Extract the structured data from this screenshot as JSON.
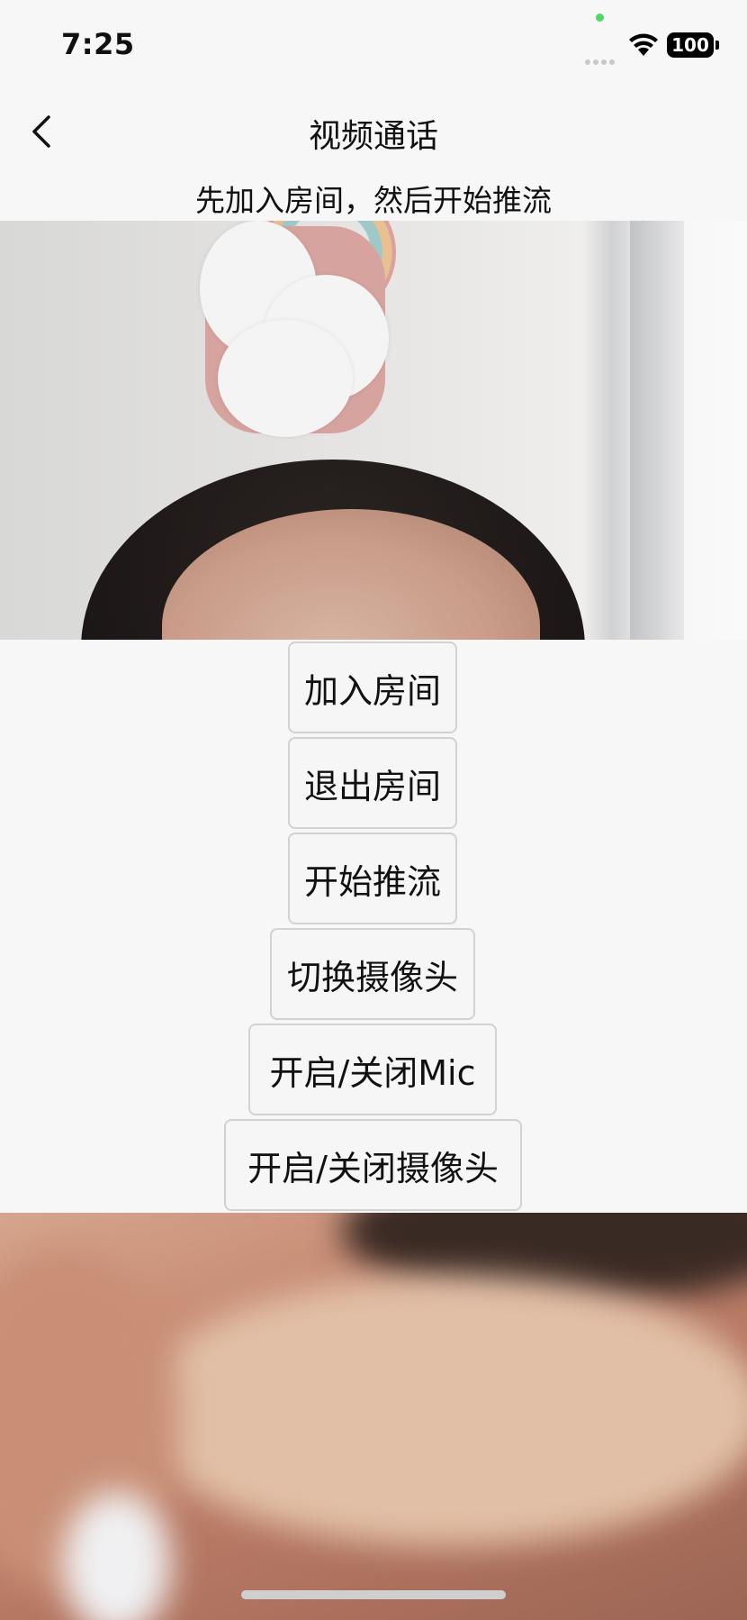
{
  "status_bar": {
    "time": "7:25",
    "battery": "100"
  },
  "nav": {
    "title": "视频通话"
  },
  "hint": "先加入房间，然后开始推流",
  "buttons": {
    "join_room": "加入房间",
    "leave_room": "退出房间",
    "start_push": "开始推流",
    "switch_camera": "切换摄像头",
    "toggle_mic": "开启/关闭Mic",
    "toggle_camera": "开启/关闭摄像头"
  },
  "icons": {
    "back": "chevron-left-icon",
    "wifi": "wifi-icon",
    "battery": "battery-icon",
    "signal": "cellular-signal-icon"
  },
  "colors": {
    "background": "#f7f7f7",
    "button_border": "#d2d2d2",
    "mic_indicator": "#4cd964"
  }
}
